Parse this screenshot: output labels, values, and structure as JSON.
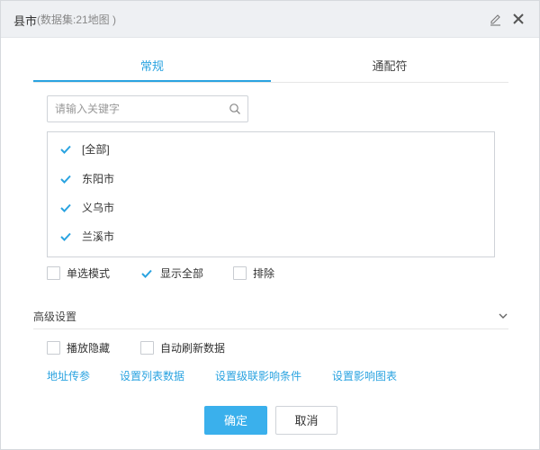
{
  "dialog": {
    "title": "县市",
    "subtitle": "(数据集:21地图 )",
    "icons": {
      "edit": "edit-icon",
      "close": "close-icon"
    }
  },
  "tabs": [
    {
      "label": "常规",
      "active": true
    },
    {
      "label": "通配符",
      "active": false
    }
  ],
  "search": {
    "placeholder": "请输入关键字",
    "value": "",
    "icon": "search-icon"
  },
  "list": {
    "items": [
      {
        "label": "[全部]",
        "checked": true
      },
      {
        "label": "东阳市",
        "checked": true
      },
      {
        "label": "义乌市",
        "checked": true
      },
      {
        "label": "兰溪市",
        "checked": true
      }
    ]
  },
  "options": [
    {
      "label": "单选模式",
      "checked": false
    },
    {
      "label": "显示全部",
      "checked": true
    },
    {
      "label": "排除",
      "checked": false
    }
  ],
  "advanced": {
    "title": "高级设置",
    "expanded": false,
    "options": [
      {
        "label": "播放隐藏",
        "checked": false
      },
      {
        "label": "自动刷新数据",
        "checked": false
      }
    ],
    "links": [
      "地址传参",
      "设置列表数据",
      "设置级联影响条件",
      "设置影响图表"
    ]
  },
  "buttons": {
    "ok": "确定",
    "cancel": "取消"
  },
  "colors": {
    "accent": "#2aa3e0",
    "primary_button": "#3ab0ec",
    "titlebar": "#eef0f3"
  }
}
